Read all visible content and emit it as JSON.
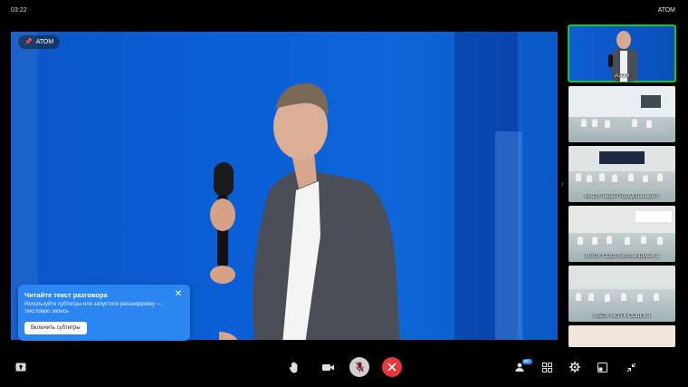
{
  "topbar": {
    "time": "03:22",
    "room_name": "АТОМ"
  },
  "stage": {
    "pin_label": "АТОМ"
  },
  "subtitle_card": {
    "title": "Читайте текст разговора",
    "text": "Используйте субтитры или запустите расшифровку — текстовую запись",
    "button_label": "Включить субтитры",
    "close_glyph": "✕"
  },
  "tiles": [
    {
      "label": "АТОМ"
    },
    {
      "label": ""
    },
    {
      "label": "МАОУ-Лицей Город-Лесной З"
    },
    {
      "label": "МАОУ СОШ поселок Дубки З"
    },
    {
      "label": "МБОУ МО ГК СОШ 3 З"
    },
    {
      "label": ""
    }
  ],
  "colors": {
    "active_tile": "#1fc51f",
    "hangup": "#e23a3a",
    "stage_blue": "#0b5fd6",
    "card_blue": "#2b86f2"
  },
  "toolbar": {
    "share_icon": "screen-share-icon",
    "hand_icon": "raise-hand-icon",
    "camera_icon": "camera-icon",
    "mic_icon": "microphone-muted-icon",
    "hangup_icon": "hang-up-icon",
    "participants_badge": "99+",
    "participants_icon": "participants-icon",
    "grid_icon": "grid-layout-icon",
    "settings_icon": "gear-icon",
    "pip_icon": "picture-in-picture-icon",
    "fullscreen_icon": "exit-fullscreen-icon"
  }
}
